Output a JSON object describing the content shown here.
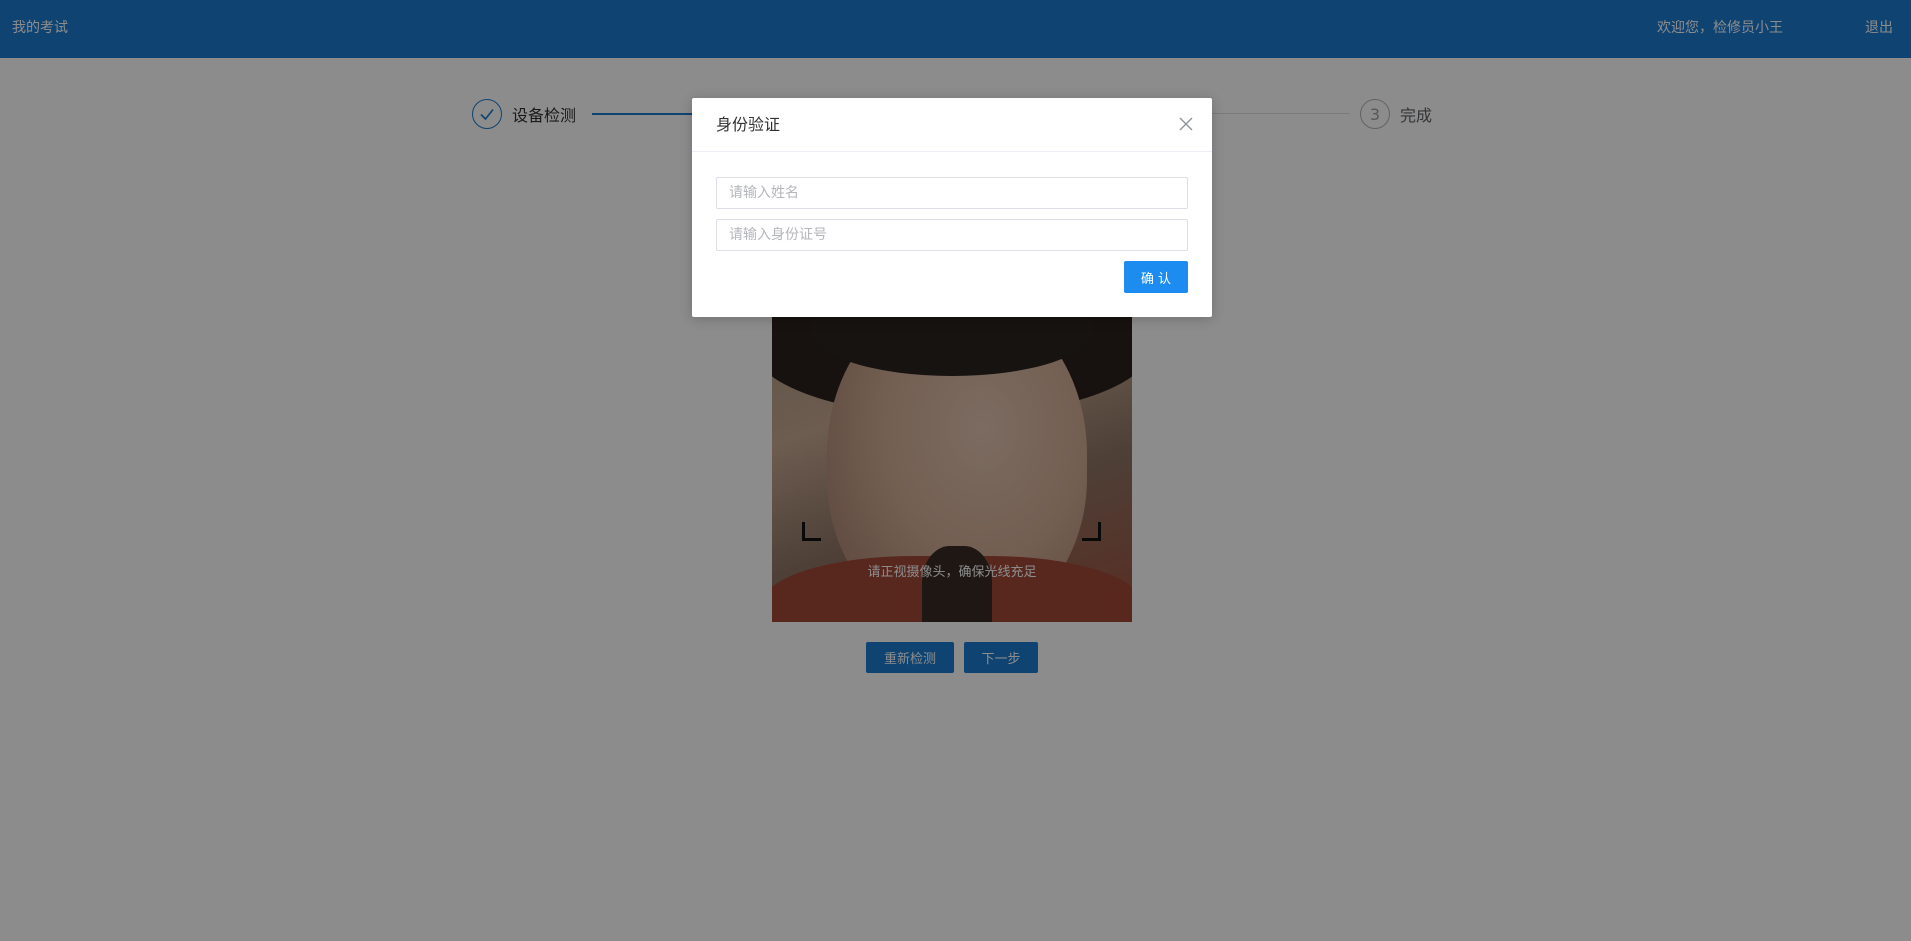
{
  "header": {
    "title": "我的考试",
    "welcome": "欢迎您，检修员小王",
    "logout": "退出"
  },
  "steps": [
    {
      "label": "设备检测",
      "status": "done"
    },
    {
      "number": "3",
      "label": "完成",
      "status": "pending"
    }
  ],
  "camera": {
    "hint": "请正视摄像头，确保光线充足"
  },
  "actions": {
    "recheck_label": "重新检测",
    "next_label": "下一步"
  },
  "dialog": {
    "title": "身份验证",
    "name_placeholder": "请输入姓名",
    "id_placeholder": "请输入身份证号",
    "confirm_label": "确 认"
  },
  "colors": {
    "primary": "#1a7ad0",
    "confirm": "#1c8cf0",
    "overlay": "rgba(0,0,0,0.45)"
  },
  "icons": {
    "step_done": "check-icon",
    "dialog_close": "close-icon"
  }
}
